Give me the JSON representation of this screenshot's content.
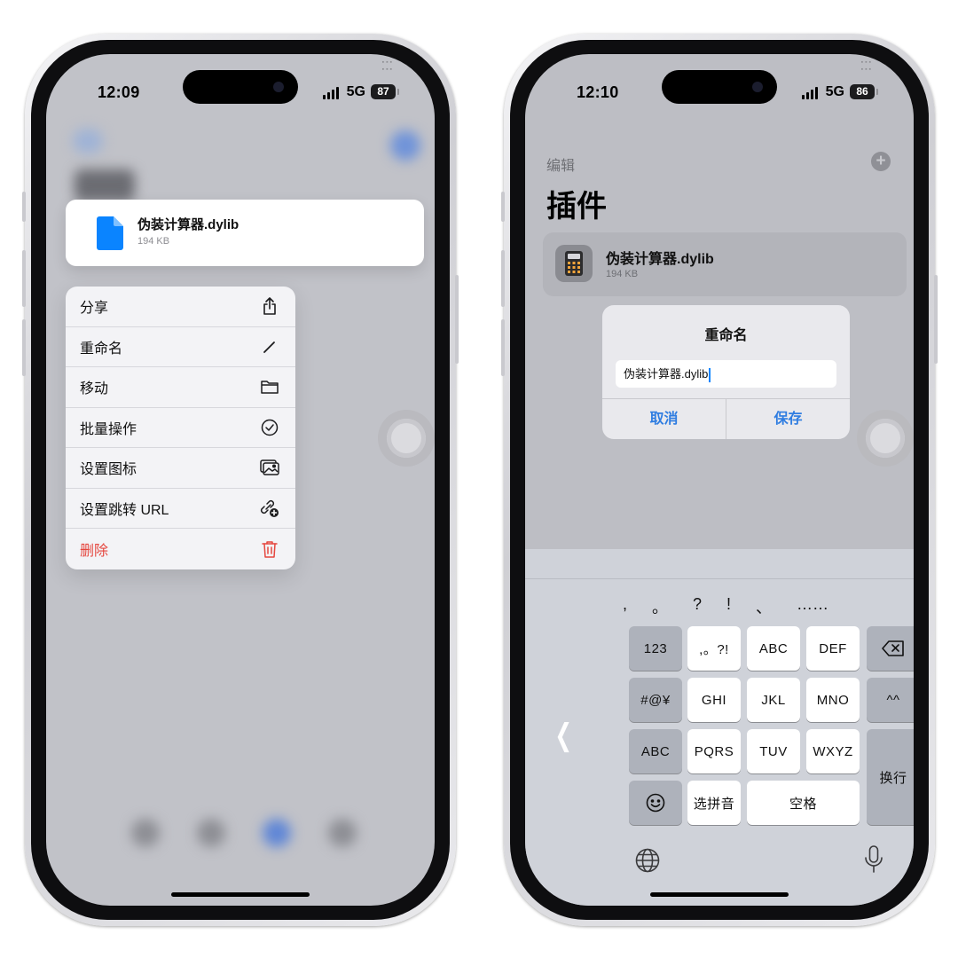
{
  "left_phone": {
    "status": {
      "time": "12:09",
      "network": "5G",
      "battery": "87"
    },
    "preview": {
      "file_name": "伪装计算器.dylib",
      "file_size": "194 KB",
      "icon": "document-icon"
    },
    "menu": [
      {
        "label": "分享",
        "icon": "share-icon"
      },
      {
        "label": "重命名",
        "icon": "pencil-icon"
      },
      {
        "label": "移动",
        "icon": "folder-icon"
      },
      {
        "label": "批量操作",
        "icon": "checkmark-circle-icon"
      },
      {
        "label": "设置图标",
        "icon": "photo-icon"
      },
      {
        "label": "设置跳转 URL",
        "icon": "link-add-icon"
      },
      {
        "label": "删除",
        "icon": "trash-icon",
        "destructive": true
      }
    ]
  },
  "right_phone": {
    "status": {
      "time": "12:10",
      "network": "5G",
      "battery": "86"
    },
    "nav": {
      "edit": "编辑",
      "add_icon": "plus-circle-icon"
    },
    "title": "插件",
    "plugin": {
      "name": "伪装计算器.dylib",
      "size": "194 KB",
      "icon": "calculator-icon"
    },
    "alert": {
      "title": "重命名",
      "field_value": "伪装计算器.dylib",
      "cancel": "取消",
      "save": "保存"
    },
    "keyboard": {
      "candidates": [
        ",",
        "。",
        "?",
        "!",
        "、",
        "……"
      ],
      "keys": {
        "k123": "123",
        "punct": ",。?!",
        "abc": "ABC",
        "def": "DEF",
        "symbols": "#@¥",
        "ghi": "GHI",
        "jkl": "JKL",
        "mno": "MNO",
        "emoticon": "^^",
        "abc_mode": "ABC",
        "pqrs": "PQRS",
        "tuv": "TUV",
        "wxyz": "WXYZ",
        "return": "换行",
        "pinyin": "选拼音",
        "space": "空格"
      }
    }
  },
  "colors": {
    "accent": "#2f7de1",
    "destructive": "#e5463e",
    "file_blue": "#0a84ff"
  }
}
